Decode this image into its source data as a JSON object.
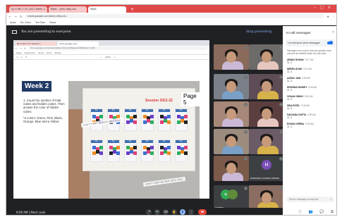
{
  "browser": {
    "tabs": [
      "Ep 4 Wk 2 Ch 2021 Week 2…",
      "Meet – bmk-rdfg-ceu",
      "Meet"
    ],
    "new_tab": "+",
    "window_controls": "–□×",
    "url": "meet.google.com/bmk-rdfg-ceu",
    "bookmarks": [
      "Apps",
      "My Class",
      "YouTube",
      "Maps"
    ]
  },
  "meet": {
    "presenting_text": "You are presenting to everyone",
    "stop_label": "Stop presenting",
    "time": "9:09 AM | Meet code",
    "controls": [
      "🎤",
      "📷",
      "⌫",
      "✋",
      "⬆",
      "⋮",
      "☎"
    ]
  },
  "shared": {
    "tabs": [
      "Ep 4 Wk 2 Ch Session…",
      "docs.google.com"
    ],
    "url": "docs.google.com/presentation/d/1m2v8aaa/edit#slide=id.p5",
    "bookmarks": [
      "Apps",
      "Classroom",
      "Drive",
      "Docs",
      "Slides"
    ],
    "toolbar": [
      "◁",
      "▷",
      "↺",
      "Q",
      "−",
      "+"
    ],
    "zoom_text": "100%",
    "week": "Week 2",
    "instructions": [
      "1. Count the number of total cubes and hidden cubes. Then answer the color of hidden cubes.",
      "*3 colors: Green, Pink, Black, Orange, Blue and a Yellow"
    ],
    "photo": {
      "session": "Session 2021-22",
      "page": "Page 5",
      "card_label": "No.",
      "tape_text": "DON'T TURN THE PAGE UNTIL TOLD"
    }
  },
  "participants": [
    {
      "name": "",
      "initial": "",
      "color": "#8a6a5a"
    },
    {
      "name": "",
      "initial": "",
      "color": "#6d6a6a"
    },
    {
      "name": "",
      "initial": "",
      "color": "#7a7f88"
    },
    {
      "name": "",
      "initial": "",
      "color": "#5e4d56"
    },
    {
      "name": "",
      "initial": "",
      "color": "#a58878"
    },
    {
      "name": "",
      "initial": "",
      "color": "#5b3f3f"
    },
    {
      "name": "",
      "initial": "",
      "color": "#9b8c7e"
    },
    {
      "name": "",
      "initial": "",
      "color": "#6b5b66"
    },
    {
      "name": "",
      "initial": "",
      "color": "#7c5a4a"
    },
    {
      "name": "HARSHIKA CHAKRA SHOWA",
      "initial": "H",
      "color": "#7b4fb8"
    },
    {
      "name": "OTHERS",
      "initial": "+",
      "color": "#34a853"
    },
    {
      "name": "",
      "initial": "",
      "color": "#8b6d62"
    }
  ],
  "chat": {
    "title": "In-call messages",
    "close": "×",
    "toggle_label": "Let everyone send messages",
    "note": "Messages can only be seen by people in the call and are deleted when the call ends.",
    "messages": [
      {
        "who": "ARNAV ROHAN",
        "when": "9:07 AM",
        "text": "11, 3"
      },
      {
        "who": "MEERA SHAH",
        "when": "9:07 AM",
        "text": "11, 4"
      },
      {
        "who": "AARAV JAIN",
        "when": "9:08 AM",
        "text": "11, 3"
      },
      {
        "who": "KRISHNA PANDEY",
        "when": "9:08 AM",
        "text": "11, 3"
      },
      {
        "who": "VIVAAN SINGH",
        "when": "9:08 AM",
        "text": "11, 3"
      },
      {
        "who": "ISHA PATEL",
        "when": "9:08 AM",
        "text": "11, 3"
      },
      {
        "who": "SANJANA GUPTA",
        "when": "9:09 AM",
        "text": "11, 3"
      },
      {
        "who": "ROHAN VERMA",
        "when": "9:09 AM",
        "text": "11, 3"
      }
    ],
    "send_placeholder": "Send a message to everyone",
    "send_icon": "➤"
  },
  "right_controls": "ⓘ 👥 💬 ⧉",
  "colors": {
    "accent": "#8ab4f8",
    "danger": "#ea4335",
    "week_bg": "#1f3864",
    "tabbar": "#e04848"
  }
}
